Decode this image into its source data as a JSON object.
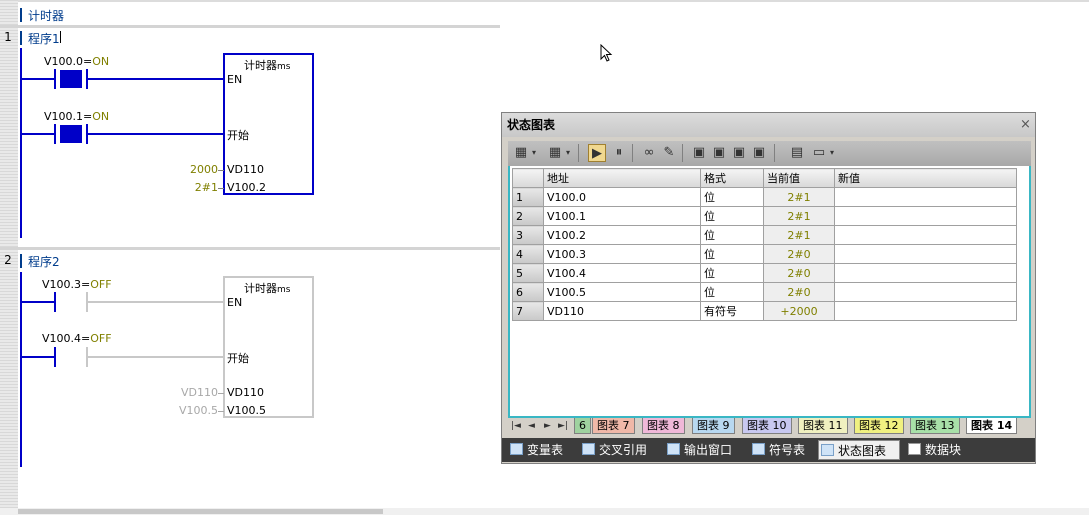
{
  "editor": {
    "section_title": "计时器",
    "networks": [
      {
        "number": "1",
        "title": "程序1",
        "contacts": [
          {
            "address": "V100.0=",
            "state": "ON"
          },
          {
            "address": "V100.1=",
            "state": "ON"
          }
        ],
        "block": {
          "name": "计时器",
          "unit": "ms",
          "pins": [
            "EN",
            "开始",
            "VD110",
            "V100.2"
          ],
          "params": [
            "2000",
            "2#1"
          ]
        }
      },
      {
        "number": "2",
        "title": "程序2",
        "contacts": [
          {
            "address": "V100.3=",
            "state": "OFF"
          },
          {
            "address": "V100.4=",
            "state": "OFF"
          }
        ],
        "block": {
          "name": "计时器",
          "unit": "ms",
          "pins": [
            "EN",
            "开始",
            "VD110",
            "V100.5"
          ],
          "params": [
            "VD110",
            "V100.5"
          ]
        }
      }
    ]
  },
  "status_chart": {
    "title": "状态图表",
    "close_label": "×",
    "columns": [
      "地址",
      "格式",
      "当前值",
      "新值"
    ],
    "rows": [
      {
        "n": "1",
        "address": "V100.0",
        "format": "位",
        "current": "2#1",
        "new": ""
      },
      {
        "n": "2",
        "address": "V100.1",
        "format": "位",
        "current": "2#1",
        "new": ""
      },
      {
        "n": "3",
        "address": "V100.2",
        "format": "位",
        "current": "2#1",
        "new": ""
      },
      {
        "n": "4",
        "address": "V100.3",
        "format": "位",
        "current": "2#0",
        "new": ""
      },
      {
        "n": "5",
        "address": "V100.4",
        "format": "位",
        "current": "2#0",
        "new": ""
      },
      {
        "n": "6",
        "address": "V100.5",
        "format": "位",
        "current": "2#0",
        "new": ""
      },
      {
        "n": "7",
        "address": "VD110",
        "format": "有符号",
        "current": "+2000",
        "new": ""
      }
    ],
    "sheet_tabs": [
      {
        "label": "6",
        "color": "#9fd29f"
      },
      {
        "label": "图表 7",
        "color": "#f0b8a8"
      },
      {
        "label": "图表 8",
        "color": "#f0b8d8"
      },
      {
        "label": "图表 9",
        "color": "#b8d8f0"
      },
      {
        "label": "图表 10",
        "color": "#c8c8f0"
      },
      {
        "label": "图表 11",
        "color": "#f0f0c0"
      },
      {
        "label": "图表 12",
        "color": "#f0f080"
      },
      {
        "label": "图表 13",
        "color": "#a8e0a8"
      },
      {
        "label": "图表 14",
        "color": "#ffffff"
      }
    ],
    "nav_arrows": [
      "|◄",
      "◄",
      "►",
      "►|"
    ]
  },
  "bottom_tabs": [
    {
      "label": "变量表",
      "active": false
    },
    {
      "label": "交叉引用",
      "active": false
    },
    {
      "label": "输出窗口",
      "active": false
    },
    {
      "label": "符号表",
      "active": false
    },
    {
      "label": "状态图表",
      "active": true
    },
    {
      "label": "数据块",
      "active": false
    }
  ]
}
